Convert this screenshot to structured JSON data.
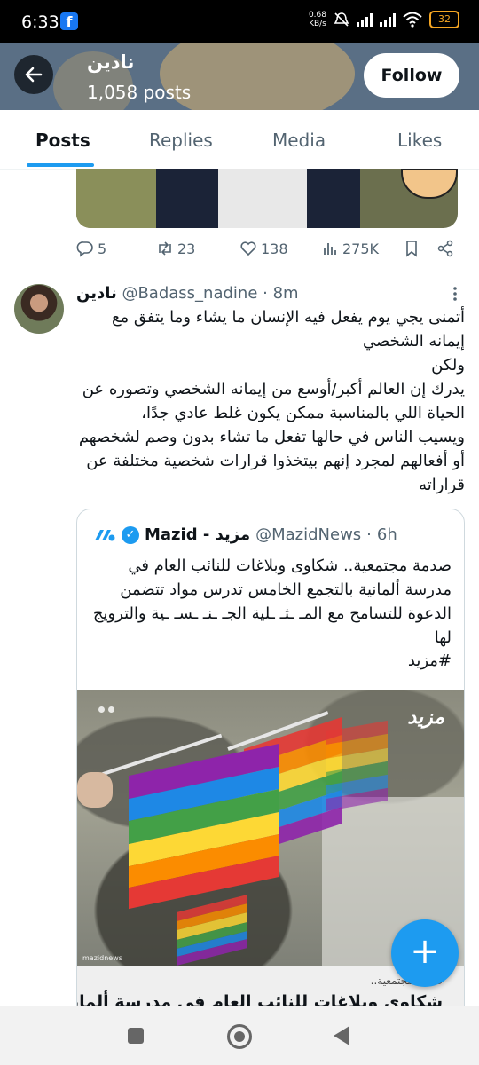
{
  "status_bar": {
    "time": "6:33",
    "app_badge": "f",
    "speed_value": "0.68",
    "speed_unit": "KB/s",
    "battery": "32"
  },
  "header": {
    "name": "نادين",
    "posts_count": "1,058 posts",
    "follow_label": "Follow"
  },
  "tabs": [
    {
      "label": "Posts",
      "active": true
    },
    {
      "label": "Replies",
      "active": false
    },
    {
      "label": "Media",
      "active": false
    },
    {
      "label": "Likes",
      "active": false
    }
  ],
  "prev_tweet_actions": {
    "replies": "5",
    "reposts": "23",
    "likes": "138",
    "views": "275K"
  },
  "tweet": {
    "display_name": "نادين",
    "handle": "@Badass_nadine",
    "separator": "·",
    "time": "8m",
    "text": "أتمنى يجي يوم يفعل فيه الإنسان ما يشاء وما يتفق مع إيمانه الشخصي\nولكن\nيدرك إن العالم أكبر/أوسع من إيمانه الشخصي وتصوره عن الحياة اللي بالمناسبة ممكن يكون غلط عادي جدًا،\nويسيب الناس في حالها تفعل ما تشاء بدون وصم لشخصهم أو أفعالهم لمجرد إنهم بيتخذوا قرارات شخصية مختلفة عن قراراته"
  },
  "quote": {
    "display_name": "Mazid - مزيد",
    "handle": "@MazidNews",
    "separator": "·",
    "time": "6h",
    "text": "صدمة مجتمعية.. شكاوى وبلاغات للنائب العام في مدرسة ألمانية بالتجمع الخامس تدرس مواد تتضمن الدعوة للتسامح مع المـ ـثـ ـلية الجـ ـنـ ـسـ ـية والترويج لها",
    "hashtag": "#مزيد",
    "image_watermark": "مزيد",
    "image_footer": "mazidnews",
    "card_category": "صدمة مجتمعية..",
    "card_title": "شكاوى وبلاغات للنائب العام في مدرسة ألمانية"
  },
  "fab_icon": "+",
  "colors": {
    "accent": "#1d9bf0",
    "text": "#0f1419",
    "muted": "#536471"
  }
}
